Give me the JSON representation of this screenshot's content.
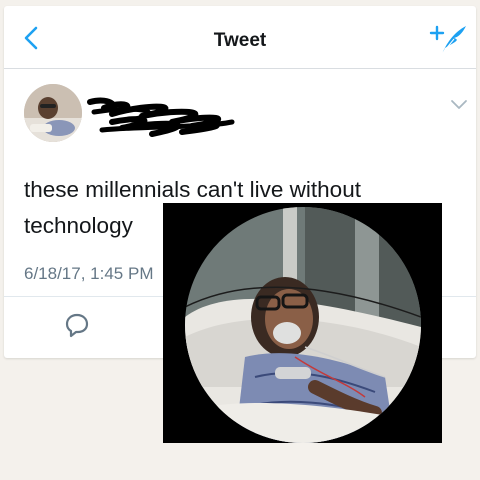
{
  "navbar": {
    "title": "Tweet",
    "back_icon": "chevron-left-icon",
    "compose_icon": "compose-feather-icon",
    "accent_color": "#1da1f2"
  },
  "tweet": {
    "text": "these millennials can't live without technology",
    "timestamp": "6/18/17, 1:45 PM",
    "author_name_redacted": true,
    "menu_icon": "chevron-down-icon",
    "reply_icon": "reply-bubble-icon"
  },
  "overlay_photo": {
    "icon": "hospital-patient-photo"
  }
}
